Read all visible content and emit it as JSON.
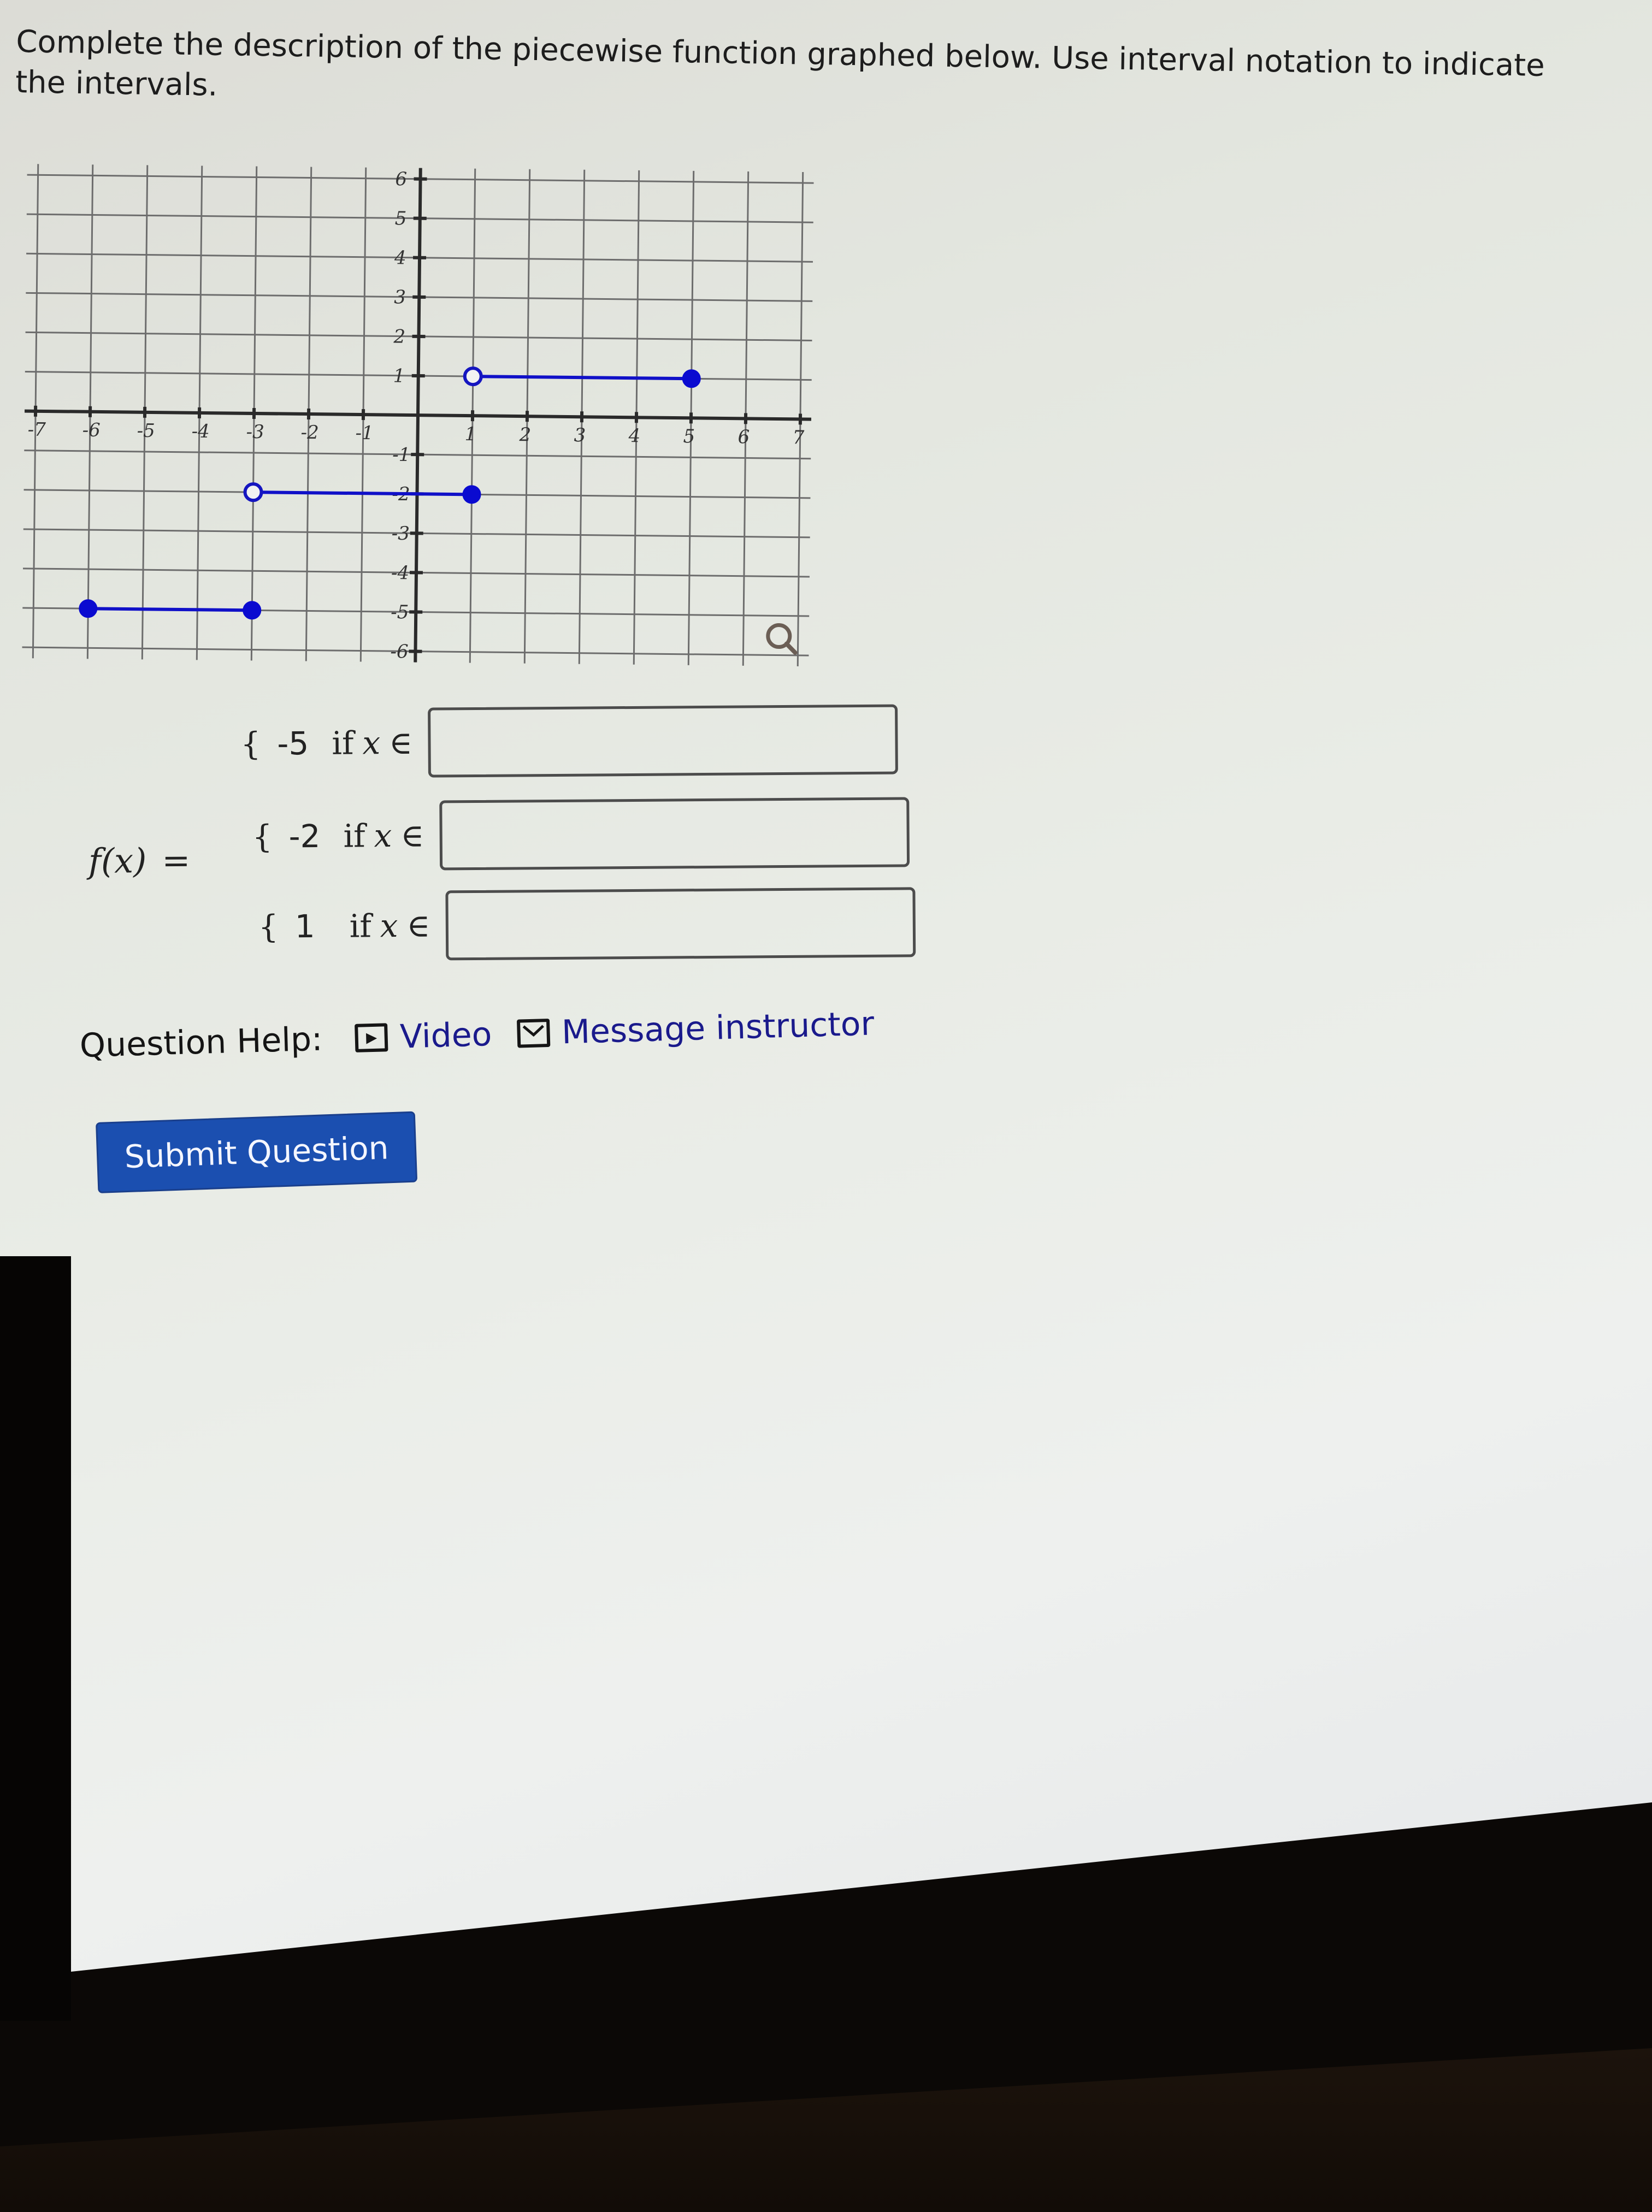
{
  "question": {
    "prompt": "Complete the description of the piecewise function graphed below. Use interval notation to indicate the intervals."
  },
  "graph": {
    "x_ticks": [
      "-7",
      "-6",
      "-5",
      "-4",
      "-3",
      "-2",
      "-1",
      "1",
      "2",
      "3",
      "4",
      "5",
      "6",
      "7"
    ],
    "y_ticks": [
      "6",
      "5",
      "4",
      "3",
      "2",
      "1",
      "-1",
      "-2",
      "-3",
      "-4",
      "-5",
      "-6"
    ],
    "zoom_icon": "magnifier-icon",
    "colors": {
      "segment": "#1010c8",
      "grid": "#6d6d6d"
    }
  },
  "chart_data": {
    "type": "line",
    "title": "",
    "xlabel": "",
    "ylabel": "",
    "xlim": [
      -7,
      7
    ],
    "ylim": [
      -6,
      6
    ],
    "grid": true,
    "x_ticks": [
      -7,
      -6,
      -5,
      -4,
      -3,
      -2,
      -1,
      1,
      2,
      3,
      4,
      5,
      6,
      7
    ],
    "y_ticks": [
      -6,
      -5,
      -4,
      -3,
      -2,
      -1,
      1,
      2,
      3,
      4,
      5,
      6
    ],
    "series": [
      {
        "name": "piece-1",
        "y": -5,
        "x_start": -6,
        "x_end": -3,
        "start_closed": true,
        "end_closed": true
      },
      {
        "name": "piece-2",
        "y": -2,
        "x_start": -3,
        "x_end": 1,
        "start_closed": false,
        "end_closed": true
      },
      {
        "name": "piece-3",
        "y": 1,
        "x_start": 1,
        "x_end": 5,
        "start_closed": false,
        "end_closed": true
      }
    ]
  },
  "piecewise": {
    "function_label": "f(x)",
    "equals": "=",
    "rows": [
      {
        "brace": "{",
        "value": "-5",
        "if": "if",
        "var": "x",
        "in": "∈",
        "input_value": "",
        "placeholder": ""
      },
      {
        "brace": "{",
        "value": "-2",
        "if": "if",
        "var": "x",
        "in": "∈",
        "input_value": "",
        "placeholder": ""
      },
      {
        "brace": "{",
        "value": "1",
        "if": "if",
        "var": "x",
        "in": "∈",
        "input_value": "",
        "placeholder": ""
      }
    ]
  },
  "help": {
    "label": "Question Help:",
    "video_label": "Video",
    "video_icon": "play-box-icon",
    "message_label": "Message instructor",
    "message_icon": "envelope-icon"
  },
  "submit": {
    "label": "Submit Question",
    "color": "#1b4fb0"
  }
}
